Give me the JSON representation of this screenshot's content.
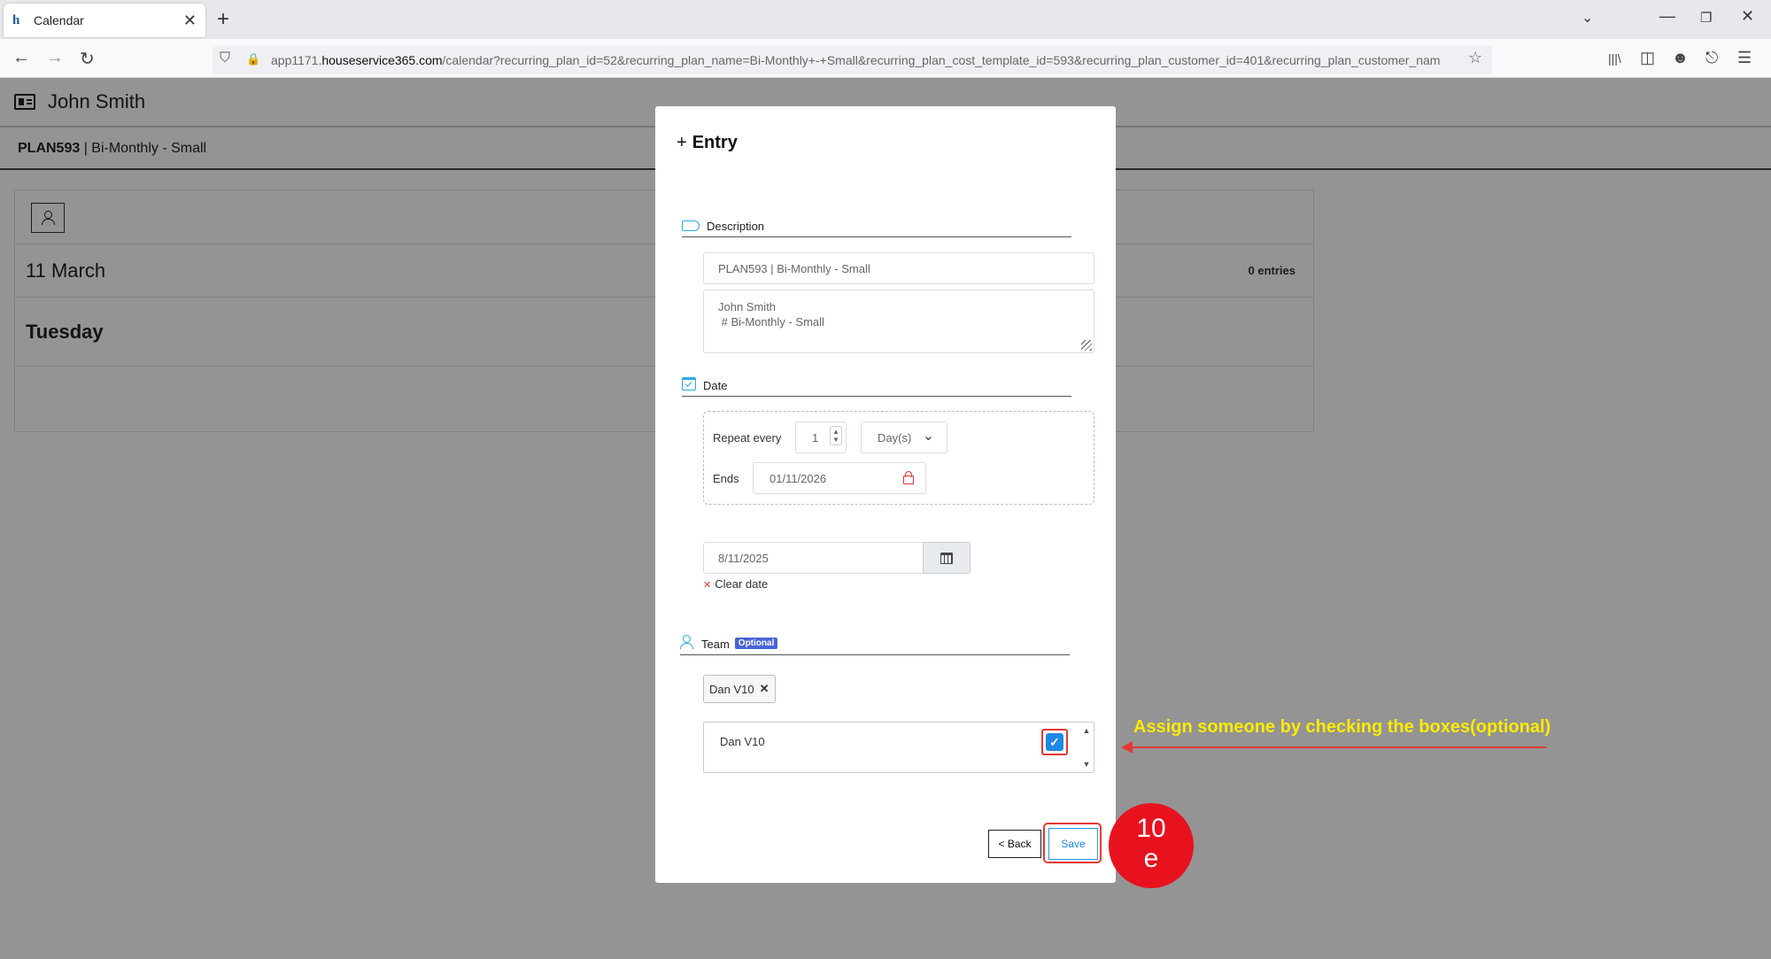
{
  "browser": {
    "tab_title": "Calendar",
    "url_prefix": "app1171.",
    "url_domain": "houseservice365.com",
    "url_path": "/calendar?recurring_plan_id=52&recurring_plan_name=Bi-Monthly+-+Small&recurring_plan_cost_template_id=593&recurring_plan_customer_id=401&recurring_plan_customer_nam"
  },
  "page": {
    "customer_name": "John Smith",
    "plan_code": "PLAN593",
    "plan_name": " | Bi-Monthly - Small",
    "date_label": "11 March",
    "day_label": "Tuesday",
    "entries_count": "0 entries"
  },
  "modal": {
    "title": "Entry",
    "description_section": "Description",
    "description_value": "PLAN593 | Bi-Monthly - Small",
    "notes_value": "John Smith\n # Bi-Monthly - Small",
    "date_section": "Date",
    "repeat_every_label": "Repeat every",
    "repeat_every_value": "1",
    "repeat_unit": "Day(s)",
    "ends_label": "Ends",
    "ends_value": "01/11/2026",
    "start_date_value": "8/11/2025",
    "clear_date_label": "Clear date",
    "team_section": "Team",
    "optional_badge": "Optional",
    "team_chip": "Dan V10",
    "team_list_item": "Dan V10",
    "team_list_checked": true,
    "back_label": "< Back",
    "save_label": "Save"
  },
  "annotations": {
    "callout_text": "Assign someone by checking the boxes(optional)",
    "step_label_line1": "10",
    "step_label_line2": "e",
    "highlight_color": "#e53935",
    "callout_color": "#ffeb00"
  },
  "icons": {
    "favicon": "h",
    "tab_close": "✕",
    "new_tab": "+",
    "back": "←",
    "forward": "→",
    "reload": "↻",
    "shield": "⛉",
    "lock": "🔒",
    "star": "☆",
    "minimize": "—",
    "restore": "❐",
    "close": "✕",
    "chevron_down": "⌄",
    "plus": "+",
    "check": "✓",
    "remove": "✕"
  }
}
